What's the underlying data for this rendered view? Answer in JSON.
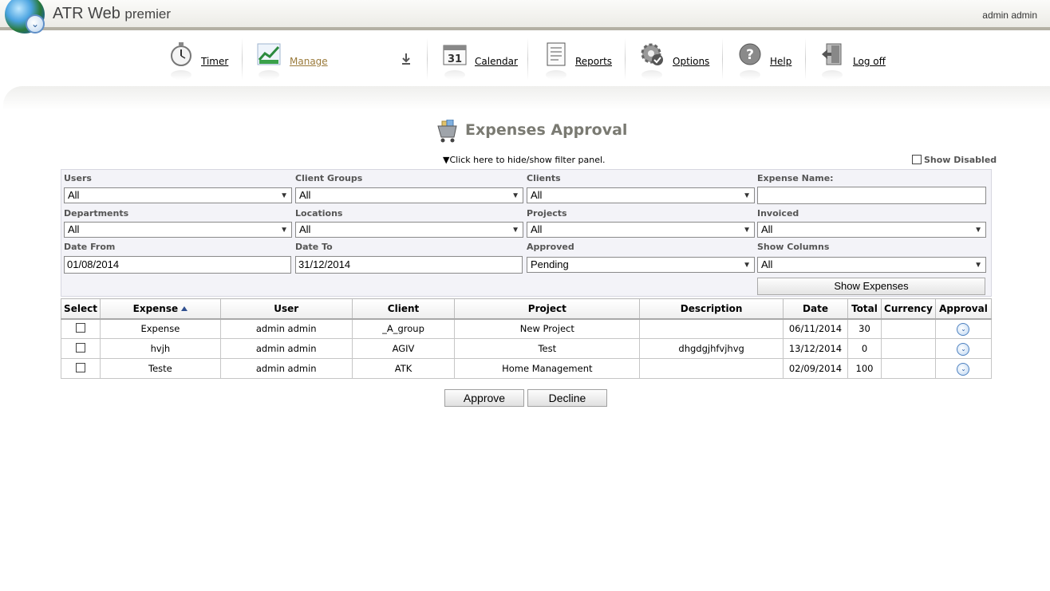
{
  "header": {
    "app_name": "ATR Web",
    "app_edition": "premier",
    "user": "admin admin"
  },
  "nav": {
    "items": [
      {
        "label": "Timer",
        "icon": "stopwatch-icon"
      },
      {
        "label": "Manage",
        "icon": "chart-icon"
      },
      {
        "label": "Calendar",
        "icon": "calendar-icon"
      },
      {
        "label": "Reports",
        "icon": "report-icon"
      },
      {
        "label": "Options",
        "icon": "gear-icon"
      },
      {
        "label": "Help",
        "icon": "help-icon"
      },
      {
        "label": "Log off",
        "icon": "logoff-icon"
      }
    ],
    "calendar_day": "31"
  },
  "page": {
    "title": "Expenses Approval",
    "filter_toggle": "Click here to hide/show filter panel.",
    "show_disabled": "Show Disabled"
  },
  "filters": {
    "users": {
      "label": "Users",
      "value": "All"
    },
    "client_groups": {
      "label": "Client Groups",
      "value": "All"
    },
    "clients": {
      "label": "Clients",
      "value": "All"
    },
    "expense_name": {
      "label": "Expense Name:",
      "value": ""
    },
    "departments": {
      "label": "Departments",
      "value": "All"
    },
    "locations": {
      "label": "Locations",
      "value": "All"
    },
    "projects": {
      "label": "Projects",
      "value": "All"
    },
    "invoiced": {
      "label": "Invoiced",
      "value": "All"
    },
    "date_from": {
      "label": "Date From",
      "value": "01/08/2014"
    },
    "date_to": {
      "label": "Date To",
      "value": "31/12/2014"
    },
    "approved": {
      "label": "Approved",
      "value": "Pending"
    },
    "show_columns": {
      "label": "Show Columns",
      "value": "All"
    },
    "show_button": "Show Expenses"
  },
  "table": {
    "columns": [
      "Select",
      "Expense",
      "User",
      "Client",
      "Project",
      "Description",
      "Date",
      "Total",
      "Currency",
      "Approval"
    ],
    "rows": [
      {
        "expense": "Expense",
        "user": "admin admin",
        "client": "_A_group",
        "project": "New Project",
        "description": "",
        "date": "06/11/2014",
        "total": "30",
        "currency": ""
      },
      {
        "expense": "hvjh",
        "user": "admin admin",
        "client": "AGIV",
        "project": "Test",
        "description": "dhgdgjhfvjhvg",
        "date": "13/12/2014",
        "total": "0",
        "currency": ""
      },
      {
        "expense": "Teste",
        "user": "admin admin",
        "client": "ATK",
        "project": "Home Management",
        "description": "",
        "date": "02/09/2014",
        "total": "100",
        "currency": ""
      }
    ]
  },
  "actions": {
    "approve": "Approve",
    "decline": "Decline"
  }
}
